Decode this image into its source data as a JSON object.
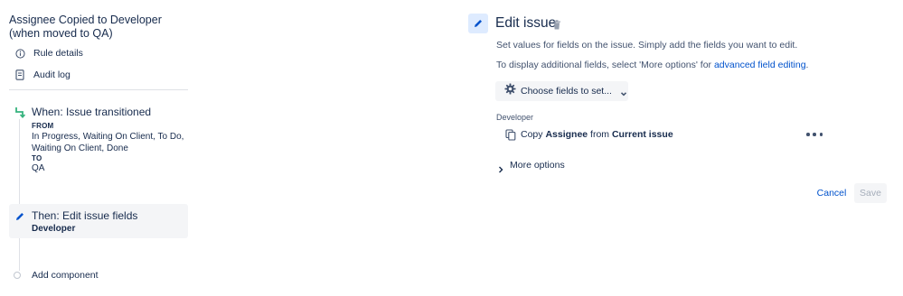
{
  "rule": {
    "title": "Assignee Copied to Developer (when moved to QA)"
  },
  "nav": {
    "rule_details": "Rule details",
    "audit_log": "Audit log"
  },
  "trigger": {
    "title": "When: Issue transitioned",
    "from_label": "FROM",
    "from_value": "In Progress, Waiting On Client, To Do, Waiting On Client, Done",
    "to_label": "TO",
    "to_value": "QA"
  },
  "action": {
    "title": "Then: Edit issue fields",
    "subtitle": "Developer"
  },
  "add_component": "Add component",
  "editor": {
    "title": "Edit issue",
    "desc1": "Set values for fields on the issue. Simply add the fields you want to edit.",
    "desc2_prefix": "To display additional fields, select 'More options' for ",
    "desc2_link": "advanced field editing",
    "desc2_suffix": ".",
    "choose_fields": "Choose fields to set...",
    "field_label": "Developer",
    "field_value": {
      "verb": "Copy",
      "source_field": "Assignee",
      "mid": "from",
      "source": "Current issue"
    },
    "more_options": "More options",
    "cancel": "Cancel",
    "save": "Save"
  },
  "icons": {
    "rule_details": "info-icon",
    "audit_log": "document-icon",
    "trigger": "transition-icon",
    "action": "pencil-icon",
    "edit": "pencil-icon",
    "delete": "trash-icon",
    "choose_fields": "gear-icon",
    "dropdown": "chevron-down-icon",
    "field_copy": "copy-icon",
    "more": "more-icon",
    "more_options": "chevron-right-icon"
  },
  "colors": {
    "accent": "#0052cc",
    "trigger_icon": "#36b37e",
    "action_icon": "#0052cc",
    "selected_bg": "#f4f5f7",
    "edit_icon_bg": "#deebff"
  }
}
